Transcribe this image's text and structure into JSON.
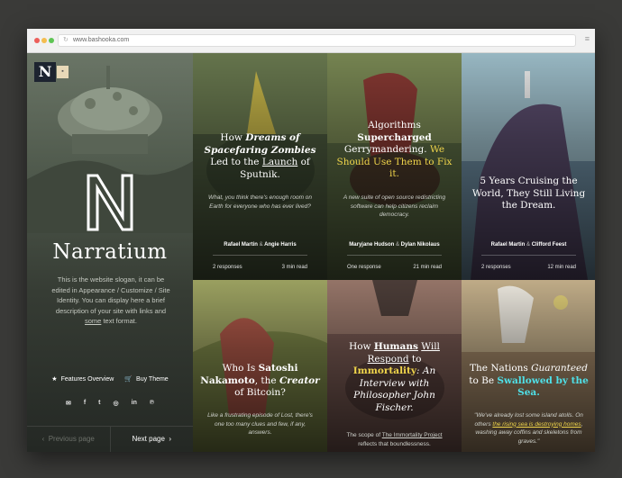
{
  "browser": {
    "url": "www.bashooka.com",
    "menu_icon": "hamburger-icon"
  },
  "sidebar": {
    "logo_letter": "N",
    "big_letter": "N",
    "site_title": "Narratium",
    "description_a": "This is the website slogan, it can be edited in Appearance / Customize / Site Identity. You can display here a brief description of your site with links and ",
    "description_link": "some",
    "description_b": " text format.",
    "features_label": "Features Overview",
    "buy_label": "Buy Theme",
    "social": [
      "email-icon",
      "facebook-icon",
      "twitter-icon",
      "instagram-icon",
      "linkedin-icon",
      "pinterest-icon"
    ],
    "prev_label": "Previous page",
    "next_label": "Next page"
  },
  "cards": [
    {
      "t1": "How ",
      "t2": "Dreams of Spacefaring Zombies",
      "t3": " Led to the ",
      "t4": "Launch",
      "t5": " of Sputnik.",
      "excerpt": "What, you think there's enough room on Earth for everyone who has ever lived?",
      "author1": "Rafael Martin",
      "amp": "&",
      "author2": "Angie Harris",
      "responses": "2 responses",
      "read": "3 min read"
    },
    {
      "t1": "Algorithms ",
      "t2": "Supercharged",
      "t3": " Gerrymandering. ",
      "t4": "We Should Use Them to Fix it.",
      "excerpt": "A new suite of open source redistricting software can help citizens reclaim democracy.",
      "author1": "Maryjane Hudson",
      "amp": "&",
      "author2": "Dylan Nikolaus",
      "responses": "One response",
      "read": "21 min read"
    },
    {
      "t1": "5 Years Cruising the World, They Still Living the Dream.",
      "author1": "Rafael Martin",
      "amp": "&",
      "author2": "Clifford Feest",
      "responses": "2 responses",
      "read": "12 min read"
    },
    {
      "t1": "Who Is ",
      "t2": "Satoshi Nakamoto",
      "t3": ", the ",
      "t4": "Creator",
      "t5": " of Bitcoin?",
      "excerpt": "Like a frustrating episode of Lost, there's one too many clues and few, if any, answers."
    },
    {
      "t1": "How ",
      "t2": "Humans",
      "t3": " ",
      "t4": "Will Respond",
      "t5": " to ",
      "t6": "Immortality",
      "t7": ": An Interview with Philosopher John Fischer.",
      "ex1": "The scope of ",
      "ex2": "The Immortality Project",
      "ex3": " reflects that boundlessness."
    },
    {
      "t1": "The Nations ",
      "t2": "Guaranteed",
      "t3": " to Be ",
      "t4": "Swallowed by the Sea.",
      "ex1": "\"We've already lost some island atolls. On others ",
      "ex2": "the rising sea is destroying homes",
      "ex3": ", washing away coffins and skeletons from graves.\""
    }
  ]
}
